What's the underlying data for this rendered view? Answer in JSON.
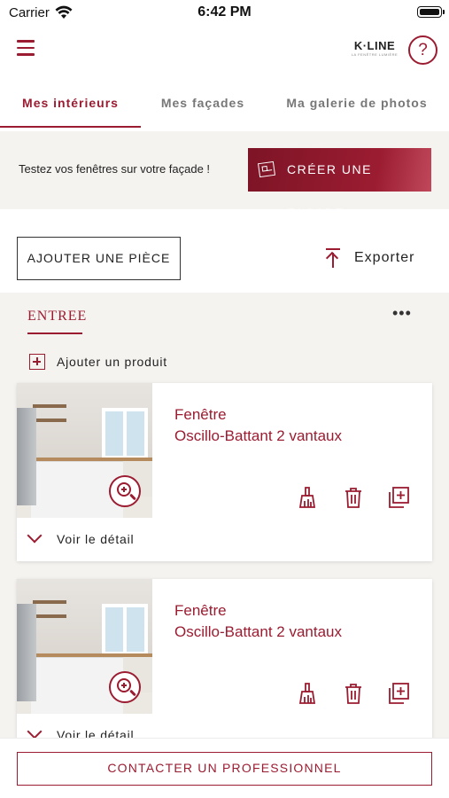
{
  "status_bar": {
    "carrier": "Carrier",
    "time": "6:42 PM"
  },
  "header": {
    "logo_text": "K·LINE",
    "logo_subtext": "LA FENÊTRE LUMIÈRE",
    "help_label": "?",
    "menu_icon": "hamburger-icon"
  },
  "tabs": [
    {
      "label": "Mes intérieurs",
      "active": true
    },
    {
      "label": "Mes façades",
      "active": false
    },
    {
      "label": "Ma galerie de photos",
      "active": false
    }
  ],
  "banner": {
    "text": "Testez vos fenêtres sur votre façade !",
    "button_label": "CRÉER UNE FAÇADE",
    "button_icon": "facade-icon"
  },
  "toolbar": {
    "add_room_label": "AJOUTER UNE PIÈCE",
    "export_label": "Exporter",
    "export_icon": "upload-icon"
  },
  "room": {
    "title": "ENTREE",
    "more_label": "•••",
    "add_product_label": "Ajouter un produit",
    "products": [
      {
        "name_line1": "Fenêtre",
        "name_line2": "Oscillo-Battant 2 vantaux",
        "detail_label": "Voir le détail"
      },
      {
        "name_line1": "Fenêtre",
        "name_line2": "Oscillo-Battant 2 vantaux",
        "detail_label": "Voir le détail"
      }
    ]
  },
  "footer": {
    "contact_label": "CONTACTER UN PROFESSIONNEL"
  },
  "colors": {
    "accent": "#9b1c31",
    "section_background": "#f5f3f0"
  }
}
